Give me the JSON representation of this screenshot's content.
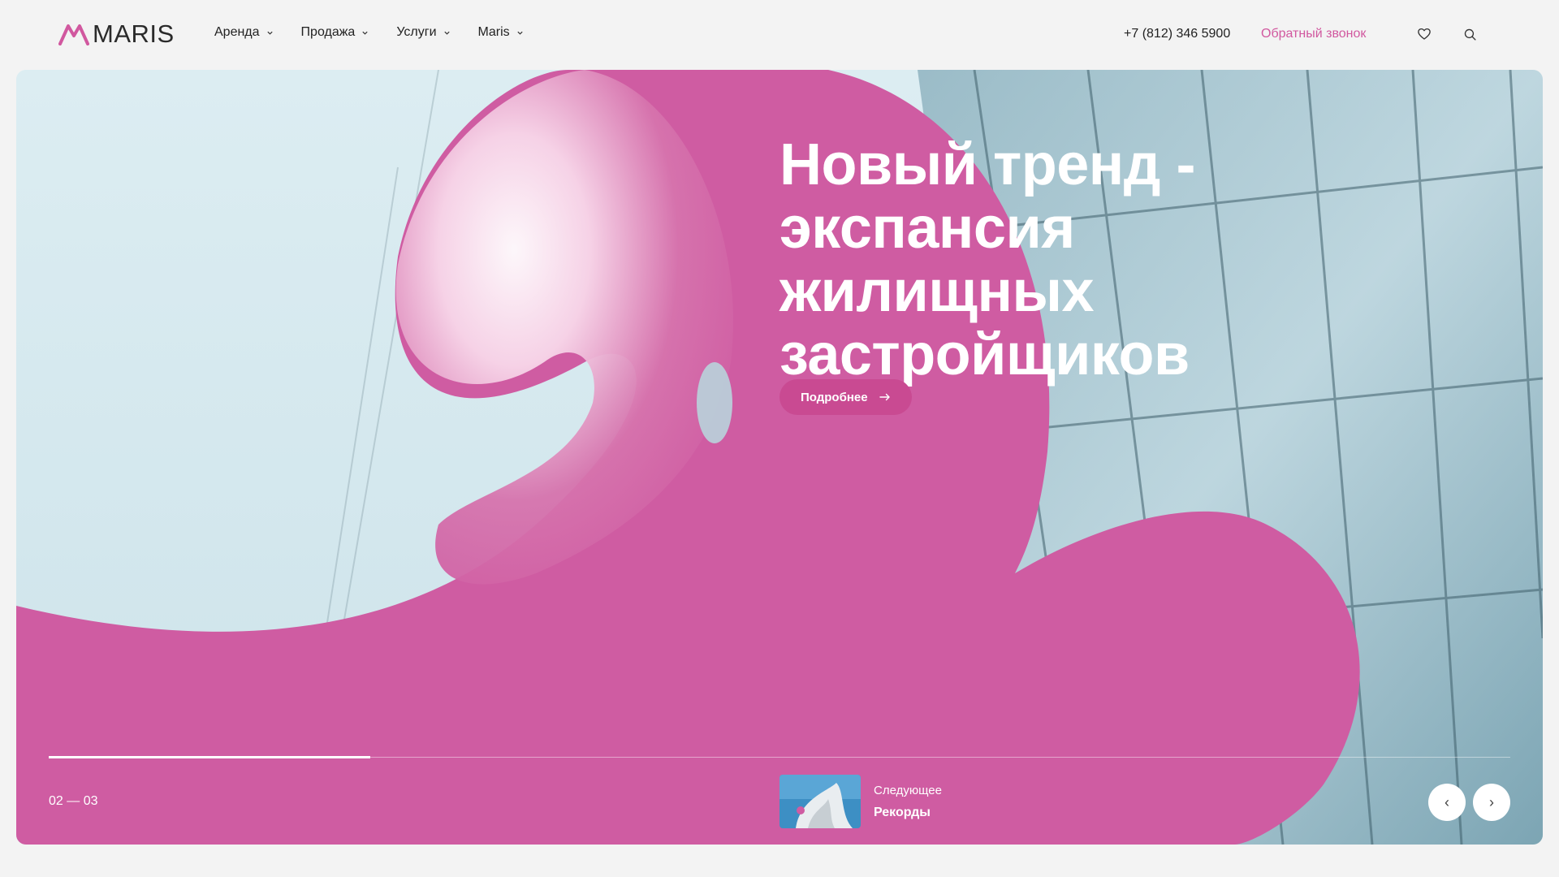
{
  "header": {
    "logo_text": "MARIS",
    "nav": [
      {
        "label": "Аренда"
      },
      {
        "label": "Продажа"
      },
      {
        "label": "Услуги"
      },
      {
        "label": "Maris"
      }
    ],
    "phone": "+7 (812) 346 5900",
    "callback": "Обратный звонок",
    "icons": [
      "heart-icon",
      "search-icon"
    ]
  },
  "hero": {
    "headline": "Новый тренд - экспансия жилищных застройщиков",
    "cta": "Подробнее",
    "counter": "02 — 03",
    "progress": 0.22,
    "next": {
      "kicker": "Следующее",
      "title": "Рекорды"
    },
    "controls": {
      "prev": "‹",
      "next": "›"
    }
  },
  "colors": {
    "accent": "#d1589f",
    "pink": "#cf5ca2",
    "bg": "#f3f3f3",
    "text": "#222222"
  }
}
